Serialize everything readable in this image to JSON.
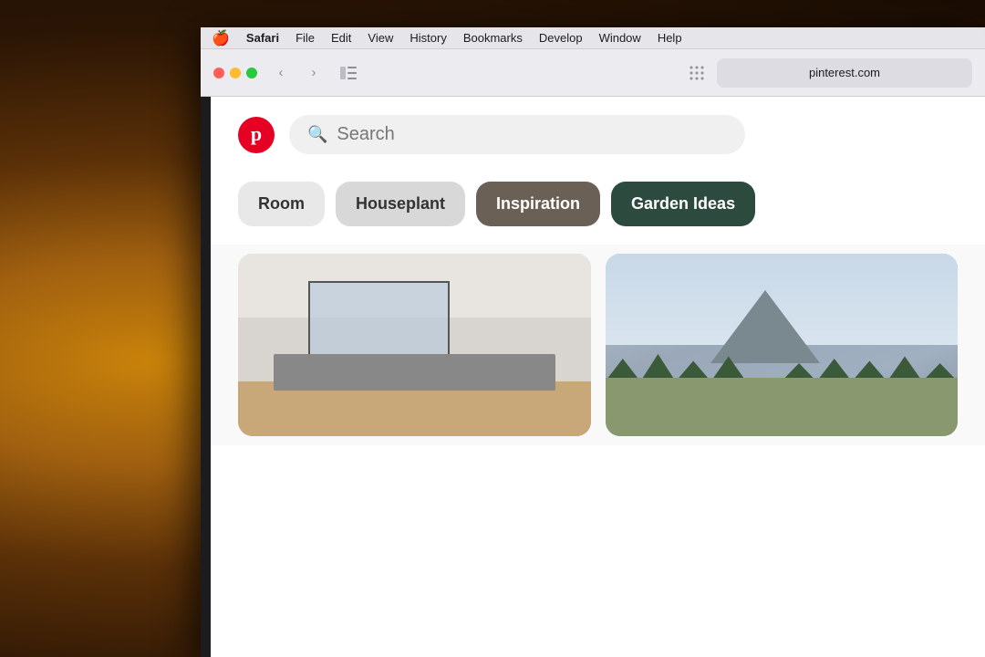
{
  "background": {
    "description": "warm ambient lamp background"
  },
  "menu_bar": {
    "apple_symbol": "🍎",
    "items": [
      {
        "label": "Safari",
        "bold": true
      },
      {
        "label": "File"
      },
      {
        "label": "Edit"
      },
      {
        "label": "View"
      },
      {
        "label": "History"
      },
      {
        "label": "Bookmarks"
      },
      {
        "label": "Develop"
      },
      {
        "label": "Window"
      },
      {
        "label": "Help"
      }
    ]
  },
  "safari_toolbar": {
    "nav": {
      "back_label": "‹",
      "forward_label": "›"
    },
    "sidebar_label": "⊞",
    "grid_label": "⠿",
    "address_bar_value": "pinterest.com"
  },
  "pinterest": {
    "logo_letter": "p",
    "search": {
      "placeholder": "Search",
      "icon": "🔍"
    },
    "categories": [
      {
        "label": "Room",
        "style": "light"
      },
      {
        "label": "Houseplant",
        "style": "light"
      },
      {
        "label": "Inspiration",
        "style": "dark-brown"
      },
      {
        "label": "Garden Ideas",
        "style": "dark-green"
      }
    ]
  },
  "colors": {
    "pinterest_red": "#e60023",
    "chip_light": "#e8e8e8",
    "chip_dark_brown": "#6b6056",
    "chip_dark_green": "#2d4a3e",
    "text_dark": "#333333",
    "text_light": "#ffffff",
    "search_bg": "#f0f0f0",
    "search_text": "#767676"
  }
}
